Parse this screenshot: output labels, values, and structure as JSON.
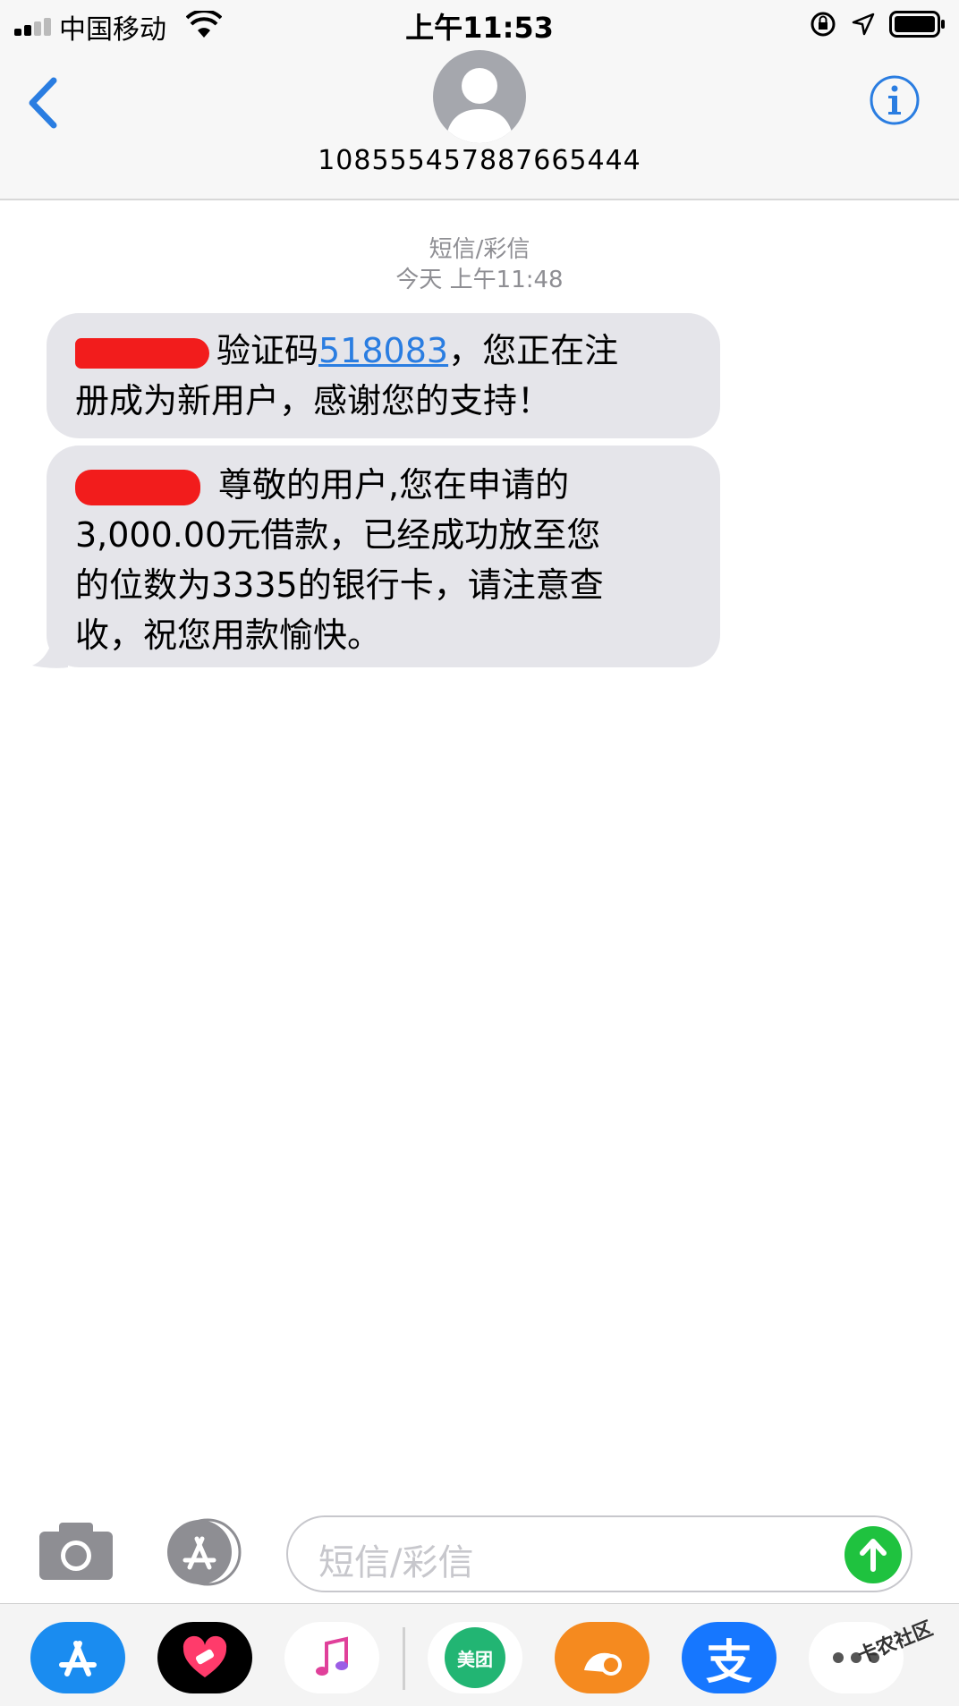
{
  "status_bar": {
    "carrier": "中国移动",
    "time": "上午11:53"
  },
  "header": {
    "contact_number": "108555457887665444"
  },
  "conversation": {
    "message_type": "短信/彩信",
    "timestamp": "今天 上午11:48",
    "messages": [
      {
        "lines": [
          {
            "before": "验证码",
            "code": "518083",
            "after": "，您正在注"
          },
          {
            "text": "册成为新用户，感谢您的支持！"
          }
        ]
      },
      {
        "lines": [
          {
            "text": "尊敬的用户,您在申请的"
          },
          {
            "text": "3,000.00元借款，已经成功放至您"
          },
          {
            "text": "的位数为3335的银行卡，请注意查"
          },
          {
            "text": "收，祝您用款愉快。"
          }
        ]
      }
    ]
  },
  "compose": {
    "placeholder": "短信/彩信"
  },
  "app_drawer": {
    "apps": [
      "app-store",
      "heart-app",
      "music",
      "美团",
      "uc-browser",
      "支",
      "more"
    ],
    "meituan_label": "美团",
    "alipay_label": "支"
  },
  "watermark": "卡农社区",
  "colors": {
    "link": "#2a7de1",
    "bubble": "#e5e5ea",
    "accent_blue": "#2a7de1",
    "send_green": "#1fc23f",
    "redaction": "#f21c1c"
  }
}
